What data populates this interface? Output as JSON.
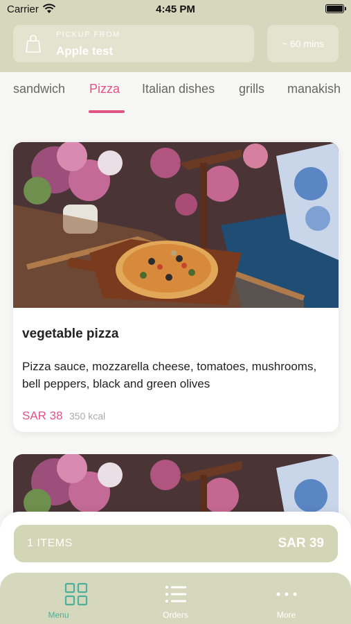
{
  "status_bar": {
    "carrier": "Carrier",
    "time": "4:45 PM"
  },
  "header": {
    "pickup_label": "PICKUP FROM",
    "store_name": "Apple test",
    "eta": "~ 60 mins"
  },
  "tabs": [
    {
      "label": "sandwich",
      "active": false
    },
    {
      "label": "Pizza",
      "active": true
    },
    {
      "label": "Italian dishes",
      "active": false
    },
    {
      "label": "grills",
      "active": false
    },
    {
      "label": "manakish",
      "active": false
    }
  ],
  "menu_items": [
    {
      "name": "vegetable pizza",
      "description": "Pizza sauce, mozzarella cheese, tomatoes, mushrooms, bell peppers, black and green olives",
      "price": "SAR 38",
      "calories": "350 kcal"
    }
  ],
  "cart": {
    "items": "1 ITEMS",
    "total": "SAR 39"
  },
  "bottom_nav": [
    {
      "label": "Menu",
      "icon": "grid-icon",
      "active": true
    },
    {
      "label": "Orders",
      "icon": "list-icon",
      "active": false
    },
    {
      "label": "More",
      "icon": "more-dots-icon",
      "active": false
    }
  ],
  "colors": {
    "header_bg": "#d6d8bd",
    "accent": "#e05383",
    "nav_active": "#4caf9a"
  }
}
